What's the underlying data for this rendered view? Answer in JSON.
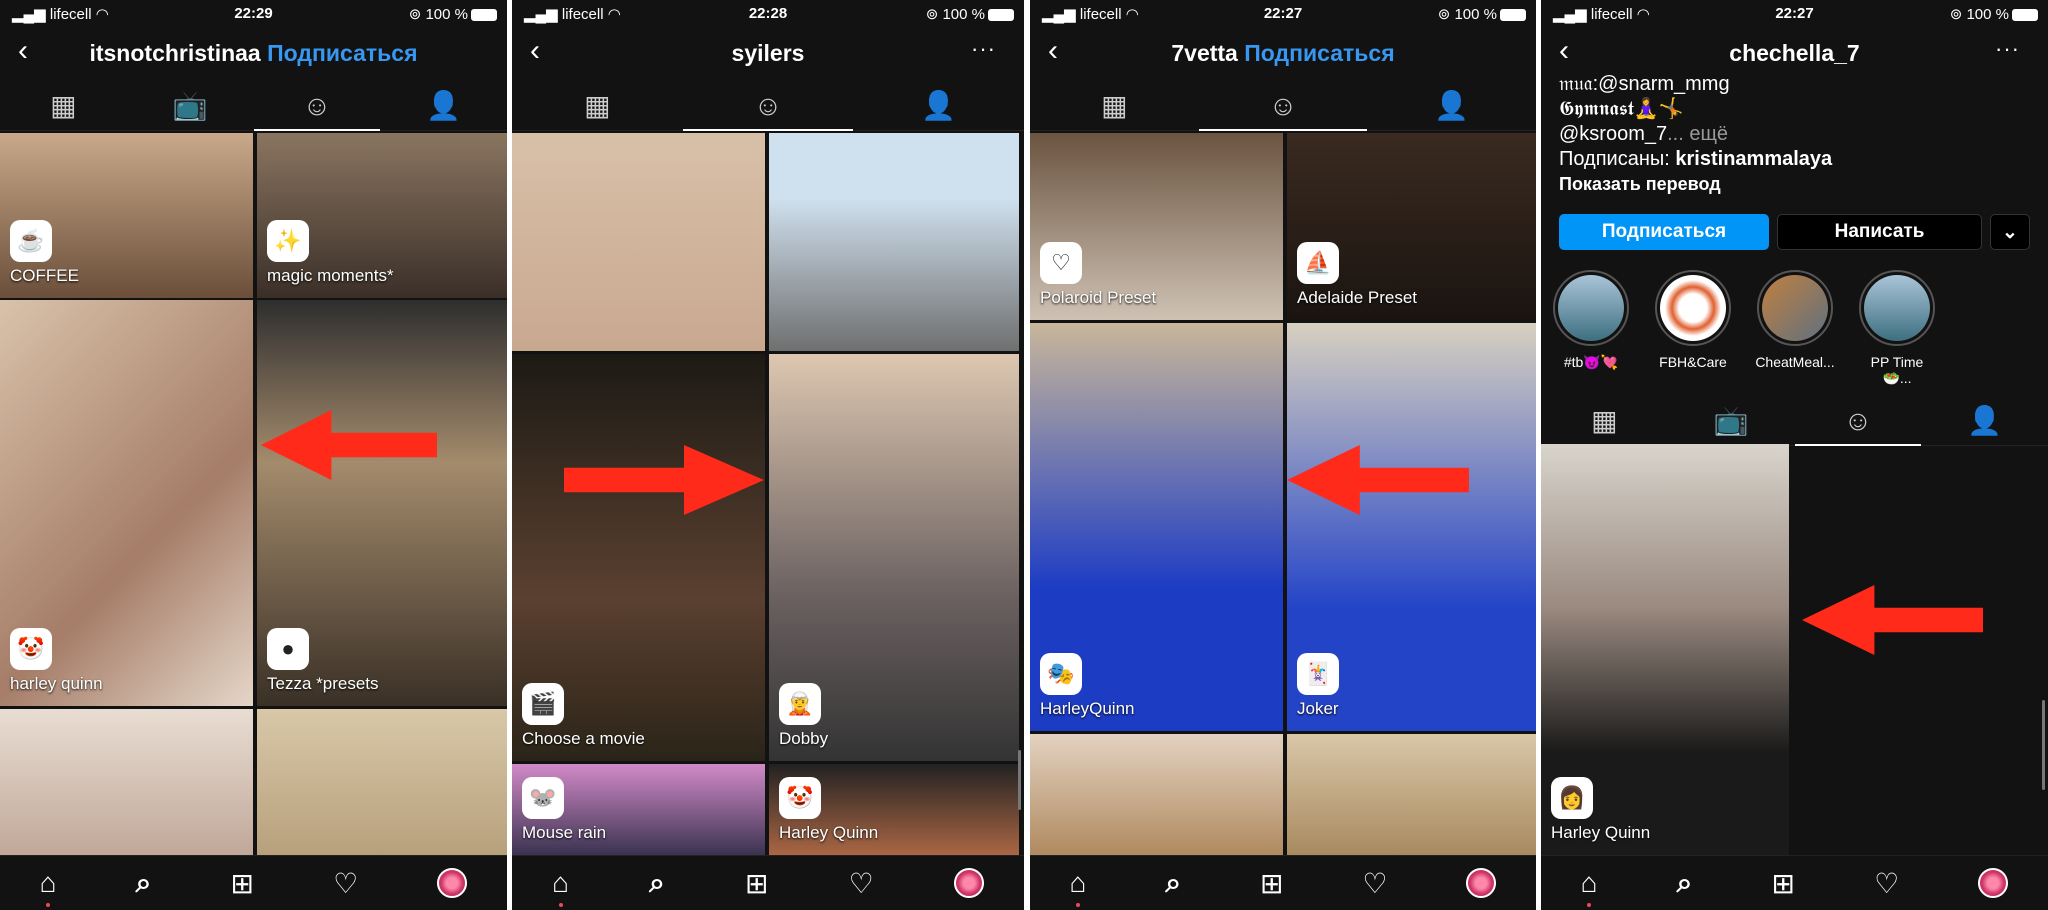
{
  "colors": {
    "background": "#121212",
    "link": "#3897f0",
    "arrow": "#ff2a1a",
    "follow_button": "#0095f6"
  },
  "panels": [
    {
      "status": {
        "carrier": "lifecell",
        "time": "22:29",
        "battery": "100 %"
      },
      "header": {
        "username": "itsnotchristinaa",
        "follow": "Подписаться"
      },
      "tabs": [
        "grid-icon",
        "igtv-icon",
        "effects-icon",
        "tagged-icon"
      ],
      "tiles": [
        {
          "label": "COFFEE",
          "icon": "☕"
        },
        {
          "label": "magic moments*",
          "icon": "✨"
        },
        {
          "label": "harley quinn",
          "icon": "🤡"
        },
        {
          "label": "Tezza *presets",
          "icon": "●"
        },
        {
          "label": "",
          "icon": ""
        },
        {
          "label": "",
          "icon": ""
        }
      ],
      "arrow": "left"
    },
    {
      "status": {
        "carrier": "lifecell",
        "time": "22:28",
        "battery": "100 %"
      },
      "header": {
        "username": "syilers",
        "more": "···"
      },
      "tabs": [
        "grid-icon",
        "effects-icon",
        "tagged-icon"
      ],
      "tiles": [
        {
          "label": "",
          "icon": ""
        },
        {
          "label": "",
          "icon": ""
        },
        {
          "label": "Choose a movie",
          "icon": "🎬"
        },
        {
          "label": "Dobby",
          "icon": "🧝"
        },
        {
          "label": "Mouse rain",
          "icon": "🐭"
        },
        {
          "label": "Harley Quinn",
          "icon": "🤡"
        }
      ],
      "arrow": "right"
    },
    {
      "status": {
        "carrier": "lifecell",
        "time": "22:27",
        "battery": "100 %"
      },
      "header": {
        "username": "7vetta",
        "follow": "Подписаться"
      },
      "tabs": [
        "grid-icon",
        "effects-icon",
        "tagged-icon"
      ],
      "tiles": [
        {
          "label": "Polaroid Preset",
          "icon": "♡"
        },
        {
          "label": "Adelaide Preset",
          "icon": "⛵"
        },
        {
          "label": "HarleyQuinn",
          "icon": "🎭"
        },
        {
          "label": "Joker",
          "icon": "🃏"
        },
        {
          "label": "",
          "icon": ""
        },
        {
          "label": "",
          "icon": ""
        }
      ],
      "arrow": "left"
    },
    {
      "status": {
        "carrier": "lifecell",
        "time": "22:27",
        "battery": "100 %"
      },
      "header": {
        "username": "chechella_7",
        "more": "···"
      },
      "profile": {
        "line1": "𝔪𝔲𝔞:@snarm_mmg",
        "line2": "𝕲𝖞𝖒𝖓𝖆𝖘𝖙🧘‍♀️🤸",
        "line3": "@ksroom_7",
        "more": "... ещё",
        "followed_by_label": "Подписаны: ",
        "followed_by": "kristinammalaya",
        "translate": "Показать перевод"
      },
      "buttons": {
        "follow": "Подписаться",
        "message": "Написать",
        "dropdown": "⌄"
      },
      "highlights": [
        "#tb😈💘",
        "FBH&Care",
        "CheatMeal...",
        "PP Time🥗..."
      ],
      "tabs": [
        "grid-icon",
        "igtv-icon",
        "effects-icon",
        "tagged-icon"
      ],
      "tiles": [
        {
          "label": "Harley Quinn",
          "icon": "👩"
        }
      ],
      "arrow": "left"
    }
  ],
  "nav": [
    "home-icon",
    "search-icon",
    "add-icon",
    "heart-icon",
    "profile-avatar"
  ]
}
